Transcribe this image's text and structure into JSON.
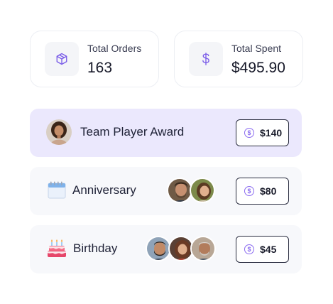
{
  "stats": {
    "orders": {
      "label": "Total Orders",
      "value": "163",
      "icon": "box-icon"
    },
    "spent": {
      "label": "Total Spent",
      "value": "$495.90",
      "icon": "dollar-icon"
    }
  },
  "rewards": [
    {
      "title": "Team Player Award",
      "amount": "$140",
      "icon": "avatar"
    },
    {
      "title": "Anniversary",
      "amount": "$80",
      "icon": "calendar-icon"
    },
    {
      "title": "Birthday",
      "amount": "$45",
      "icon": "cake-icon"
    }
  ],
  "colors": {
    "accent": "#8b6cf0",
    "highlight_row": "#ebe8fd",
    "row_bg": "#f7f8fb"
  }
}
